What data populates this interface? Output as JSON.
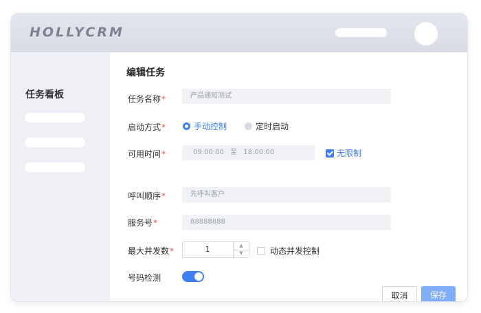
{
  "app": {
    "logo": "HOLLYCRM"
  },
  "sidebar": {
    "title": "任务看板"
  },
  "form": {
    "title": "编辑任务",
    "task_name": {
      "label": "任务名称",
      "required": "*",
      "value": "产品通知测试"
    },
    "start_mode": {
      "label": "启动方式",
      "required": "*",
      "options": [
        {
          "label": "手动控制",
          "selected": true
        },
        {
          "label": "定时启动",
          "selected": false
        }
      ]
    },
    "available_time": {
      "label": "可用时间",
      "required": "*",
      "start": "09:00:00",
      "separator": "至",
      "end": "18:00:00",
      "unlimited_label": "无限制",
      "unlimited_checked": true
    },
    "call_order": {
      "label": "呼叫顺序",
      "required": "*",
      "value": "先呼叫客户"
    },
    "service_number": {
      "label": "服务号",
      "required": "*",
      "value": "88888888"
    },
    "max_concurrency": {
      "label": "最大并发数",
      "required": "*",
      "value": "1",
      "dynamic_label": "动态并发控制",
      "dynamic_checked": false
    },
    "number_check": {
      "label": "号码检测",
      "enabled": true
    }
  },
  "buttons": {
    "cancel": "取消",
    "save": "保存"
  },
  "colors": {
    "accent": "#3e7ff5",
    "save_button": "#80adf7",
    "required": "#e34d4d"
  }
}
